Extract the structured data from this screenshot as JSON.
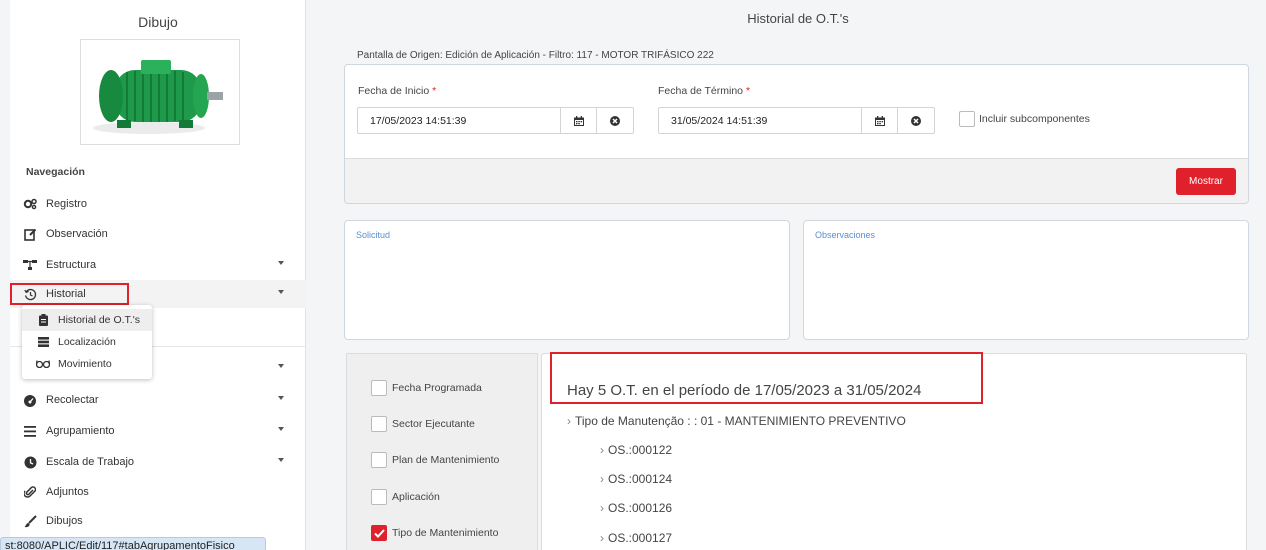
{
  "sidebar": {
    "title": "Dibujo",
    "nav_title": "Navegación",
    "items": [
      {
        "label": "Registro",
        "icon": "gears-icon"
      },
      {
        "label": "Observación",
        "icon": "edit-icon"
      },
      {
        "label": "Estructura",
        "icon": "sitemap-icon"
      },
      {
        "label": "Historial",
        "icon": "history-icon"
      },
      {
        "label": "Recolectar",
        "icon": "dashboard-icon"
      },
      {
        "label": "Agrupamiento",
        "icon": "bars-icon"
      },
      {
        "label": "Escala de Trabajo",
        "icon": "clock-icon"
      },
      {
        "label": "Adjuntos",
        "icon": "paperclip-icon"
      },
      {
        "label": "Dibujos",
        "icon": "brush-icon"
      }
    ],
    "dropdown": [
      {
        "label": "Historial de O.T.'s",
        "icon": "clipboard-icon"
      },
      {
        "label": "Localización",
        "icon": "server-icon"
      },
      {
        "label": "Movimiento",
        "icon": "glasses-icon"
      }
    ],
    "status_url": "st:8080/APLIC/Edit/117#tabAgrupamentoFisico"
  },
  "main": {
    "title": "Historial de O.T.'s",
    "origin": "Pantalla de Origen: Edición de Aplicación - Filtro: 117 - MOTOR TRIFÁSICO 222",
    "start_label": "Fecha de Inicio",
    "start_value": "17/05/2023 14:51:39",
    "end_label": "Fecha de Término",
    "end_value": "31/05/2024 14:51:39",
    "required_mark": "*",
    "include_sub": "Incluir subcomponentes",
    "show_button": "Mostrar",
    "solicitud_label": "Solicitud",
    "observaciones_label": "Observaciones",
    "options": [
      {
        "label": "Fecha Programada",
        "checked": false
      },
      {
        "label": "Sector Ejecutante",
        "checked": false
      },
      {
        "label": "Plan de Mantenimiento",
        "checked": false
      },
      {
        "label": "Aplicación",
        "checked": false
      },
      {
        "label": "Tipo de Mantenimiento",
        "checked": true
      }
    ],
    "result_title": "Hay 5 O.T. en el período de 17/05/2023 a 31/05/2024",
    "group_label": "Tipo de Manutenção : : 01 - MANTENIMIENTO PREVENTIVO",
    "orders": [
      "OS.:000122",
      "OS.:000124",
      "OS.:000126",
      "OS.:000127"
    ]
  },
  "colors": {
    "accent": "#e0202a",
    "link_label": "#5a8fd0",
    "motor": "#1f9a4a"
  }
}
